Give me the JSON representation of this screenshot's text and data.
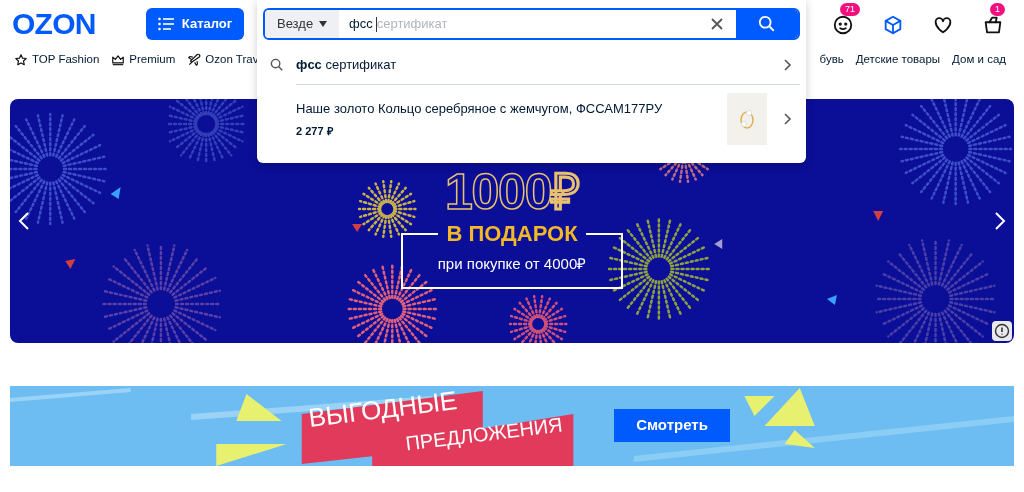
{
  "header": {
    "logo": "OZON",
    "catalog_button": "Каталог",
    "icons": [
      {
        "kind": "face",
        "badge": "71"
      },
      {
        "kind": "box"
      },
      {
        "kind": "heart"
      },
      {
        "kind": "bag",
        "badge": "1"
      }
    ]
  },
  "nav_left": [
    {
      "label": "TOP Fashion",
      "kind": "star"
    },
    {
      "label": "Premium",
      "kind": "crown"
    },
    {
      "label": "Ozon Trav",
      "kind": "plane"
    }
  ],
  "nav_right": [
    {
      "label": "бувь"
    },
    {
      "label": "Детские товары"
    },
    {
      "label": "Дом и сад"
    }
  ],
  "search": {
    "scope": "Везде",
    "value": "фсс",
    "placeholder": "сертификат",
    "suggestion": "**фсс** сертификат",
    "product": {
      "title": "Наше золото Кольцо серебряное с жемчугом, ФССАМ177РУ",
      "price": "2 277 ₽"
    }
  },
  "promo_banner": {
    "amount": "1000₽",
    "headline": "В ПОДАРОК",
    "subline": "при покупке от 4000₽"
  },
  "offers_banner": {
    "line1": "ВЫГОДНЫЕ",
    "line2": "ПРЕДЛОЖЕНИЯ",
    "button": "Смотреть"
  }
}
